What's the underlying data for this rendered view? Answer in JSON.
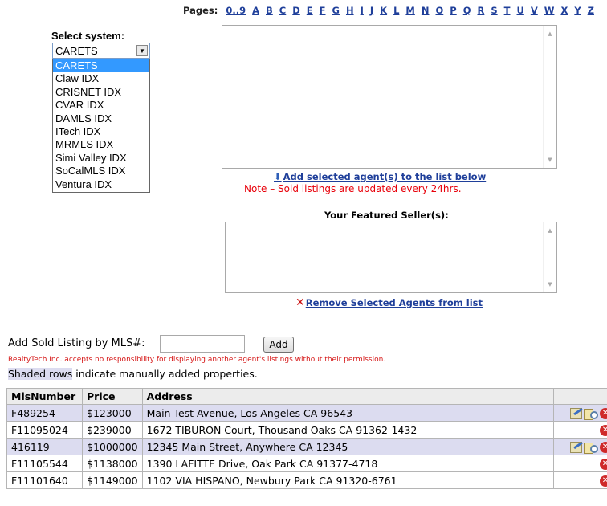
{
  "pages": {
    "label": "Pages:",
    "links": [
      "0..9",
      "A",
      "B",
      "C",
      "D",
      "E",
      "F",
      "G",
      "H",
      "I",
      "J",
      "K",
      "L",
      "M",
      "N",
      "O",
      "P",
      "Q",
      "R",
      "S",
      "T",
      "U",
      "V",
      "W",
      "X",
      "Y",
      "Z"
    ]
  },
  "system": {
    "label": "Select system:",
    "selected": "CARETS",
    "options": [
      "CARETS",
      "Claw IDX",
      "CRISNET IDX",
      "CVAR IDX",
      "DAMLS IDX",
      "ITech IDX",
      "MRMLS IDX",
      "Simi Valley IDX",
      "SoCalMLS IDX",
      "Ventura IDX"
    ]
  },
  "agents": {
    "add_link": "Add selected agent(s) to the list below",
    "note": "Note – Sold listings are updated every 24hrs.",
    "featured_label": "Your Featured Seller(s):",
    "remove_link": "Remove Selected Agents from list"
  },
  "mls": {
    "label": "Add Sold Listing by MLS#:",
    "value": "",
    "add_button": "Add",
    "disclaimer": "RealtyTech Inc. accepts no responsibility for displaying another agent's listings without their permission.",
    "shaded_highlight": "Shaded rows",
    "shaded_rest": " indicate manually added properties."
  },
  "table": {
    "headers": [
      "MlsNumber",
      "Price",
      "Address",
      ""
    ],
    "rows": [
      {
        "mls": "F489254",
        "price": "$123000",
        "address": "Main Test Avenue, Los Angeles CA 96543",
        "shaded": true
      },
      {
        "mls": "F11095024",
        "price": "$239000",
        "address": "1672 TIBURON Court, Thousand Oaks CA 91362-1432",
        "shaded": false
      },
      {
        "mls": "416119",
        "price": "$1000000",
        "address": "12345 Main Street, Anywhere CA 12345",
        "shaded": true
      },
      {
        "mls": "F11105544",
        "price": "$1138000",
        "address": "1390 LAFITTE Drive, Oak Park CA 91377-4718",
        "shaded": false
      },
      {
        "mls": "F11101640",
        "price": "$1149000",
        "address": "1102 VIA HISPANO, Newbury Park CA 91320-6761",
        "shaded": false
      }
    ]
  },
  "icons": {
    "down_arrow": "arrow-down-icon",
    "remove": "x-icon",
    "edit": "edit-icon",
    "view": "view-icon",
    "delete": "delete-icon"
  },
  "colors": {
    "link": "#1f3f9a",
    "note_red": "#e8000a",
    "shaded_row": "#dcdcf0",
    "selected_option": "#3399ff"
  }
}
